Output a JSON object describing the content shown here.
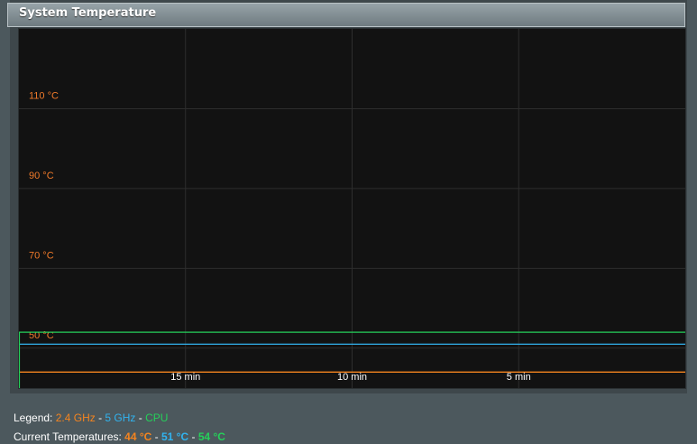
{
  "panel": {
    "title": "System Temperature"
  },
  "chart_data": {
    "type": "line",
    "y_ticks": [
      "50 °C",
      "70 °C",
      "90 °C",
      "110 °C"
    ],
    "x_ticks": [
      "15 min",
      "10 min",
      "5 min"
    ],
    "x_range_minutes_ago": [
      20,
      0
    ],
    "y_range": [
      40,
      130
    ],
    "grid": true,
    "series": [
      {
        "name": "2.4 GHz",
        "color": "#f5841f",
        "values": [
          44,
          44,
          44,
          44,
          44,
          44,
          44,
          44,
          44,
          44,
          44,
          44,
          44,
          44,
          44,
          44,
          44,
          44,
          44,
          44,
          44,
          44,
          44,
          44,
          44,
          44,
          44,
          44,
          44,
          44,
          44,
          44,
          44,
          44,
          44,
          44,
          44,
          44,
          44,
          44,
          44,
          44,
          44,
          44,
          44,
          44,
          44,
          44,
          44,
          44,
          44,
          44,
          44,
          44,
          44,
          44,
          44,
          44,
          44,
          44,
          44,
          44,
          44,
          44,
          44,
          44,
          44,
          44,
          44,
          44,
          44,
          44,
          44,
          44,
          44,
          44,
          44,
          44,
          44,
          44,
          44,
          44,
          44,
          44,
          44,
          44,
          44,
          44,
          44,
          44,
          44,
          44,
          44,
          44,
          44,
          44,
          44,
          44,
          44,
          44,
          44,
          44,
          44,
          44,
          44,
          44,
          44,
          44,
          44,
          44,
          44,
          44,
          44,
          44,
          44,
          44,
          44,
          44,
          44,
          44,
          44,
          44,
          44,
          44,
          44,
          44,
          44,
          44,
          44,
          44,
          44,
          44,
          44,
          44,
          44,
          44,
          44,
          44,
          44,
          44,
          44,
          44,
          44,
          44,
          44,
          44,
          44,
          44,
          44,
          44,
          44,
          44,
          44,
          44,
          44,
          44,
          44,
          44,
          44,
          44,
          44,
          44,
          44,
          44,
          44,
          44,
          44,
          44,
          44,
          44,
          44,
          44,
          44,
          44,
          44,
          44,
          44,
          44,
          44,
          44
        ]
      },
      {
        "name": "5 GHz",
        "color": "#31b3ef",
        "values": [
          51,
          51,
          51,
          51,
          51,
          51,
          51,
          51,
          51,
          51,
          51,
          51,
          51,
          51,
          51,
          51,
          51,
          51,
          51,
          51,
          51,
          51,
          51,
          51,
          51,
          51,
          51,
          51,
          51,
          51,
          51,
          51,
          51,
          51,
          51,
          51,
          51,
          51,
          51,
          51,
          51,
          51,
          51,
          51,
          51,
          51,
          51,
          51,
          51,
          51,
          51,
          51,
          51,
          51,
          51,
          51,
          51,
          51,
          51,
          51,
          51,
          51,
          51,
          51,
          51,
          51,
          51,
          51,
          51,
          51,
          51,
          51,
          51,
          51,
          51,
          51,
          51,
          51,
          51,
          51,
          51,
          51,
          51,
          51,
          51,
          51,
          51,
          51,
          51,
          51,
          51,
          51,
          51,
          51,
          51,
          51,
          51,
          51,
          51,
          51,
          51,
          51,
          51,
          51,
          51,
          51,
          51,
          51,
          51,
          51,
          51,
          51,
          51,
          51,
          51,
          51,
          51,
          51,
          51,
          51,
          51,
          51,
          51,
          51,
          51,
          51,
          51,
          51,
          51,
          51,
          51,
          51,
          51,
          51,
          51,
          51,
          51,
          51,
          51,
          51,
          51,
          51,
          51,
          51,
          51,
          51,
          51,
          51,
          51,
          51,
          51,
          51,
          51,
          51,
          51,
          51,
          51,
          51,
          51,
          51,
          51,
          51,
          51,
          51,
          51,
          51,
          51,
          51,
          51,
          51,
          51,
          51,
          51,
          51,
          51,
          51,
          51,
          51,
          51,
          51
        ]
      },
      {
        "name": "CPU",
        "color": "#25d05a",
        "values": [
          54,
          54,
          54,
          54,
          54,
          54,
          54,
          54,
          54,
          54,
          54,
          54,
          54,
          54,
          54,
          54,
          54,
          54,
          54,
          54,
          54,
          54,
          54,
          54,
          54,
          54,
          54,
          54,
          54,
          54,
          54,
          54,
          54,
          54,
          54,
          54,
          54,
          54,
          54,
          54,
          54,
          54,
          54,
          54,
          54,
          54,
          54,
          54,
          54,
          54,
          54,
          54,
          54,
          54,
          54,
          54,
          54,
          54,
          54,
          54,
          54,
          54,
          54,
          54,
          54,
          54,
          54,
          54,
          54,
          54,
          54,
          54,
          54,
          54,
          54,
          54,
          54,
          54,
          54,
          54,
          54,
          54,
          54,
          54,
          54,
          54,
          54,
          54,
          54,
          54,
          54,
          54,
          54,
          54,
          54,
          54,
          54,
          54,
          54,
          54,
          54,
          54,
          54,
          54,
          54,
          54,
          54,
          54,
          54,
          54,
          54,
          54,
          54,
          54,
          54,
          54,
          54,
          54,
          54,
          54,
          54,
          54,
          54,
          54,
          54,
          54,
          54,
          54,
          54,
          54,
          54,
          54,
          54,
          54,
          54,
          54,
          54,
          54,
          54,
          54,
          54,
          54,
          54,
          54,
          54,
          54,
          54,
          54,
          54,
          54,
          54,
          54,
          54,
          54,
          54,
          54,
          54,
          54,
          54,
          54,
          54,
          54,
          54,
          54,
          54,
          54,
          54,
          54,
          54,
          54,
          54,
          54,
          54,
          54,
          54,
          54,
          54,
          54,
          54,
          54
        ]
      }
    ]
  },
  "legend": {
    "prefix": "Legend: ",
    "sep1": " - ",
    "sep2": " - ",
    "items": [
      "2.4 GHz",
      "5 GHz",
      "CPU"
    ]
  },
  "current": {
    "prefix": "Current Temperatures: ",
    "sep1": " - ",
    "sep2": " - ",
    "values": [
      "44 °C",
      "51 °C",
      "54 °C"
    ]
  },
  "colors": {
    "accent_2_4": "#f5841f",
    "accent_5": "#31b3ef",
    "accent_cpu": "#25d05a"
  }
}
